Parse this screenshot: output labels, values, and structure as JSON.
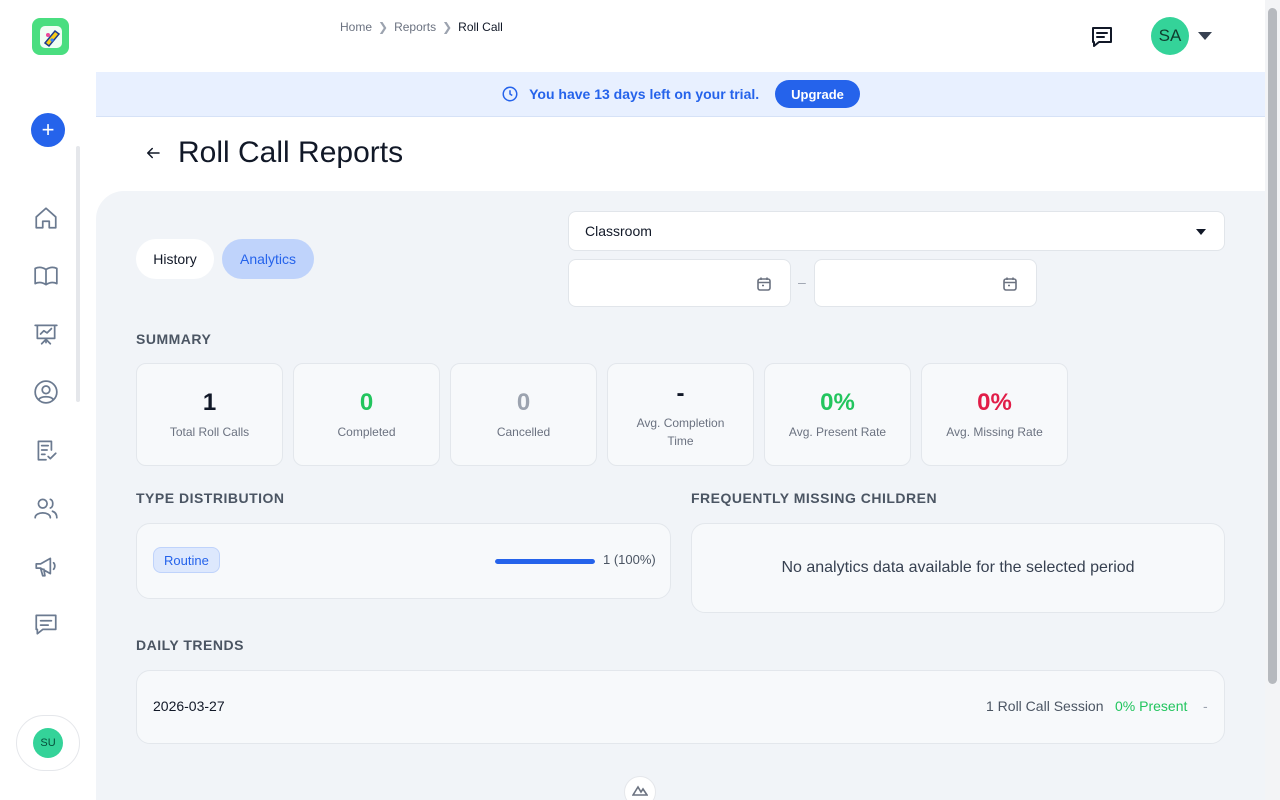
{
  "breadcrumb": [
    "Home",
    "Reports",
    "Roll Call"
  ],
  "header": {
    "user_initials": "SA"
  },
  "sidebar": {
    "user_initials": "SU",
    "icons": [
      "home-icon",
      "book-icon",
      "presentation-icon",
      "user-circle-icon",
      "clipboard-check-icon",
      "users-icon",
      "megaphone-icon",
      "message-icon"
    ]
  },
  "trial": {
    "message": "You have 13 days left on your trial.",
    "button": "Upgrade"
  },
  "page": {
    "title": "Roll Call Reports"
  },
  "tabs": {
    "history": "History",
    "analytics": "Analytics",
    "active": "Analytics"
  },
  "filters": {
    "type_value": "Classroom",
    "date_separator": "–"
  },
  "summary": {
    "title": "SUMMARY",
    "cards": [
      {
        "value": "1",
        "label": "Total Roll Calls",
        "color": "#111827"
      },
      {
        "value": "0",
        "label": "Completed",
        "color": "#22c55e"
      },
      {
        "value": "0",
        "label": "Cancelled",
        "color": "#9ca3af"
      },
      {
        "value": "-",
        "label": "Avg. Completion Time",
        "color": "#111827"
      },
      {
        "value": "0%",
        "label": "Avg. Present Rate",
        "color": "#22c55e"
      },
      {
        "value": "0%",
        "label": "Avg. Missing Rate",
        "color": "#e11d48"
      }
    ]
  },
  "type_distribution": {
    "title": "TYPE DISTRIBUTION",
    "items": [
      {
        "type": "Routine",
        "count_label": "1 (100%)",
        "fraction": 1.0
      }
    ]
  },
  "missing": {
    "title": "FREQUENTLY MISSING CHILDREN",
    "empty_message": "No analytics data available for the selected period"
  },
  "daily_trends": {
    "title": "DAILY TRENDS",
    "rows": [
      {
        "date": "2026-03-27",
        "sessions": "1 Roll Call Session",
        "present": "0% Present",
        "extra": "-"
      }
    ]
  },
  "colors": {
    "accent": "#2563eb",
    "success": "#22c55e",
    "danger": "#e11d48",
    "avatar": "#34d399"
  }
}
